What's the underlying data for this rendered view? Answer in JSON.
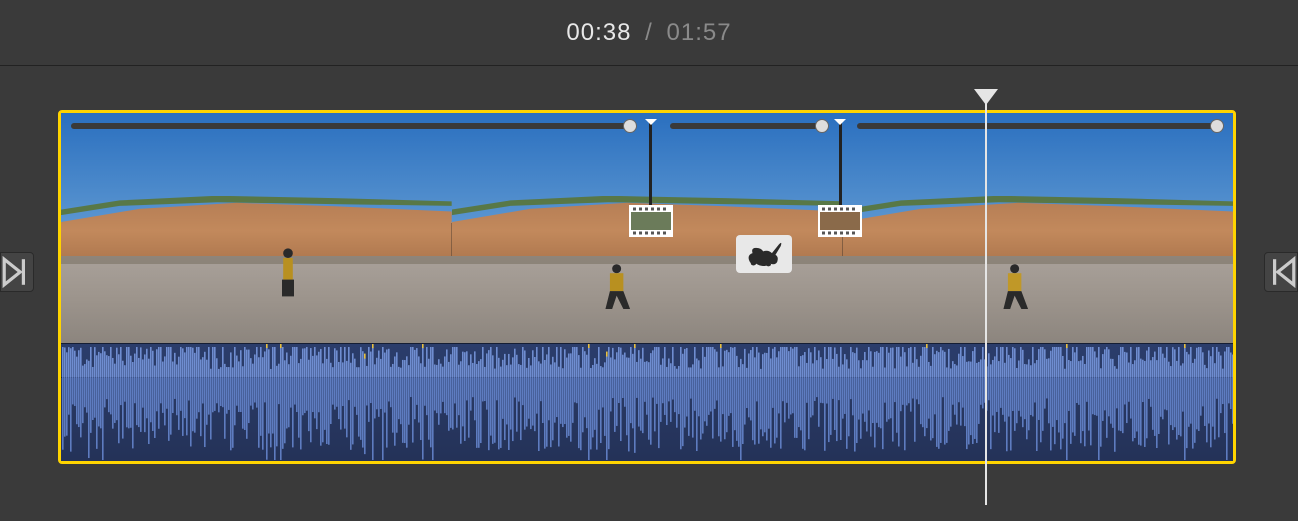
{
  "timecode": {
    "current": "00:38",
    "separator": "/",
    "total": "01:57"
  },
  "playhead": {
    "position_pct": 78.8
  },
  "speed_segments": [
    {
      "start_pct": 0.5,
      "end_pct": 48.5,
      "handle_end": true
    },
    {
      "start_pct": 52.0,
      "end_pct": 65.0,
      "handle_end": true
    },
    {
      "start_pct": 68.0,
      "end_pct": 99.0,
      "handle_end": true
    }
  ],
  "speed_markers": [
    {
      "position_pct": 50.3,
      "type": "film"
    },
    {
      "position_pct": 66.5,
      "type": "film"
    }
  ],
  "speed_badge": {
    "position_pct": 60.0,
    "icon": "rabbit"
  },
  "icons": {
    "edge_left": "clip-edge-left",
    "edge_right": "clip-edge-right"
  }
}
